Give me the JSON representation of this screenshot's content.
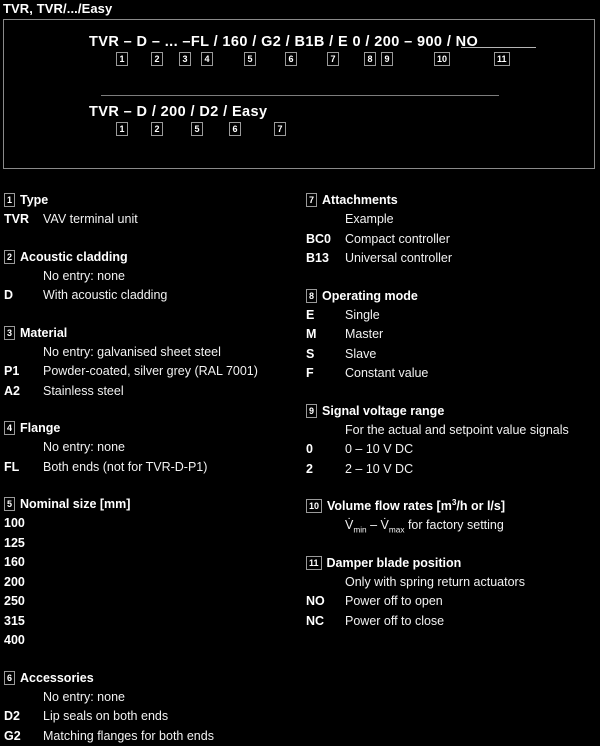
{
  "title": "TVR, TVR/.../Easy",
  "order_code": {
    "row1": {
      "code": "TVR – D – ... –FL  /  160  /  G2  /  B1B  /  E 0  /  200 – 900  /  NO",
      "segments": [
        {
          "text": "TVR",
          "badge": "1"
        },
        {
          "text": "– D",
          "badge": "2"
        },
        {
          "text": "– ...",
          "badge": "3"
        },
        {
          "text": "–FL",
          "badge": "4"
        },
        {
          "text": "160",
          "badge": "5"
        },
        {
          "text": "G2",
          "badge": "6"
        },
        {
          "text": "B1B",
          "badge": "7"
        },
        {
          "text": "E",
          "badge": "8"
        },
        {
          "text": "0",
          "badge": "9"
        },
        {
          "text": "200 – 900",
          "badge": "10"
        },
        {
          "text": "NO",
          "badge": "11"
        }
      ],
      "badges": [
        "1",
        "2",
        "3",
        "4",
        "5",
        "6",
        "7",
        "8",
        "9",
        "10",
        "11"
      ]
    },
    "row2": {
      "code": "TVR – D  /  200  /  D2  /  Easy",
      "badges": [
        "1",
        "2",
        "5",
        "6",
        "7"
      ]
    }
  },
  "legend": {
    "left": [
      {
        "no": "1",
        "title": "Type",
        "rows": [
          {
            "key": "TVR",
            "val": "VAV terminal unit"
          }
        ]
      },
      {
        "no": "2",
        "title": "Acoustic cladding",
        "rows": [
          {
            "key": "",
            "val": "No entry: none"
          },
          {
            "key": "D",
            "val": "With acoustic cladding"
          }
        ]
      },
      {
        "no": "3",
        "title": "Material",
        "rows": [
          {
            "key": "",
            "val": "No entry: galvanised sheet steel"
          },
          {
            "key": "P1",
            "val": "Powder-coated, silver grey (RAL 7001)"
          },
          {
            "key": "A2",
            "val": "Stainless steel"
          }
        ]
      },
      {
        "no": "4",
        "title": "Flange",
        "rows": [
          {
            "key": "",
            "val": "No entry: none"
          },
          {
            "key": "FL",
            "val": "Both ends (not for TVR-D-P1)"
          }
        ]
      },
      {
        "no": "5",
        "title": "Nominal size [mm]",
        "rows": [
          {
            "key": "100",
            "val": ""
          },
          {
            "key": "125",
            "val": ""
          },
          {
            "key": "160",
            "val": ""
          },
          {
            "key": "200",
            "val": ""
          },
          {
            "key": "250",
            "val": ""
          },
          {
            "key": "315",
            "val": ""
          },
          {
            "key": "400",
            "val": ""
          }
        ]
      },
      {
        "no": "6",
        "title": "Accessories",
        "rows": [
          {
            "key": "",
            "val": "No entry: none"
          },
          {
            "key": "D2",
            "val": "Lip seals on both ends"
          },
          {
            "key": "G2",
            "val": "Matching flanges for both ends"
          }
        ]
      }
    ],
    "right": [
      {
        "no": "7",
        "title": "Attachments",
        "rows": [
          {
            "key": "",
            "val": "Example"
          },
          {
            "key": "BC0",
            "val": "Compact controller"
          },
          {
            "key": "B13",
            "val": "Universal controller"
          }
        ]
      },
      {
        "no": "8",
        "title": "Operating mode",
        "rows": [
          {
            "key": "E",
            "val": "Single"
          },
          {
            "key": "M",
            "val": "Master"
          },
          {
            "key": "S",
            "val": "Slave"
          },
          {
            "key": "F",
            "val": "Constant value"
          }
        ]
      },
      {
        "no": "9",
        "title": "Signal voltage range",
        "rows": [
          {
            "key": "",
            "val": "For the actual and setpoint value signals"
          },
          {
            "key": "0",
            "val": "0 – 10 V DC"
          },
          {
            "key": "2",
            "val": "2 – 10 V DC"
          }
        ]
      },
      {
        "no": "10",
        "title": "Volume flow rates [m³/h or l/s]",
        "title_html": "Volume flow rates [m<sup>3</sup>/h or l/s]",
        "rows": [
          {
            "key": "",
            "val": "V̇min – V̇max for factory setting",
            "val_html": "V̇<sub>min</sub> – V̇<sub>max</sub> for factory setting"
          }
        ]
      },
      {
        "no": "11",
        "title": "Damper blade position",
        "rows": [
          {
            "key": "",
            "val": "Only with spring return actuators"
          },
          {
            "key": "NO",
            "val": "Power off to open"
          },
          {
            "key": "NC",
            "val": "Power off to close"
          }
        ]
      }
    ]
  },
  "colors": {
    "background": "#000000",
    "text": "#ffffff",
    "frame_border": "#8a8a8a",
    "badge_border": "#9a9a9a",
    "separator": "#7d7d7d"
  }
}
